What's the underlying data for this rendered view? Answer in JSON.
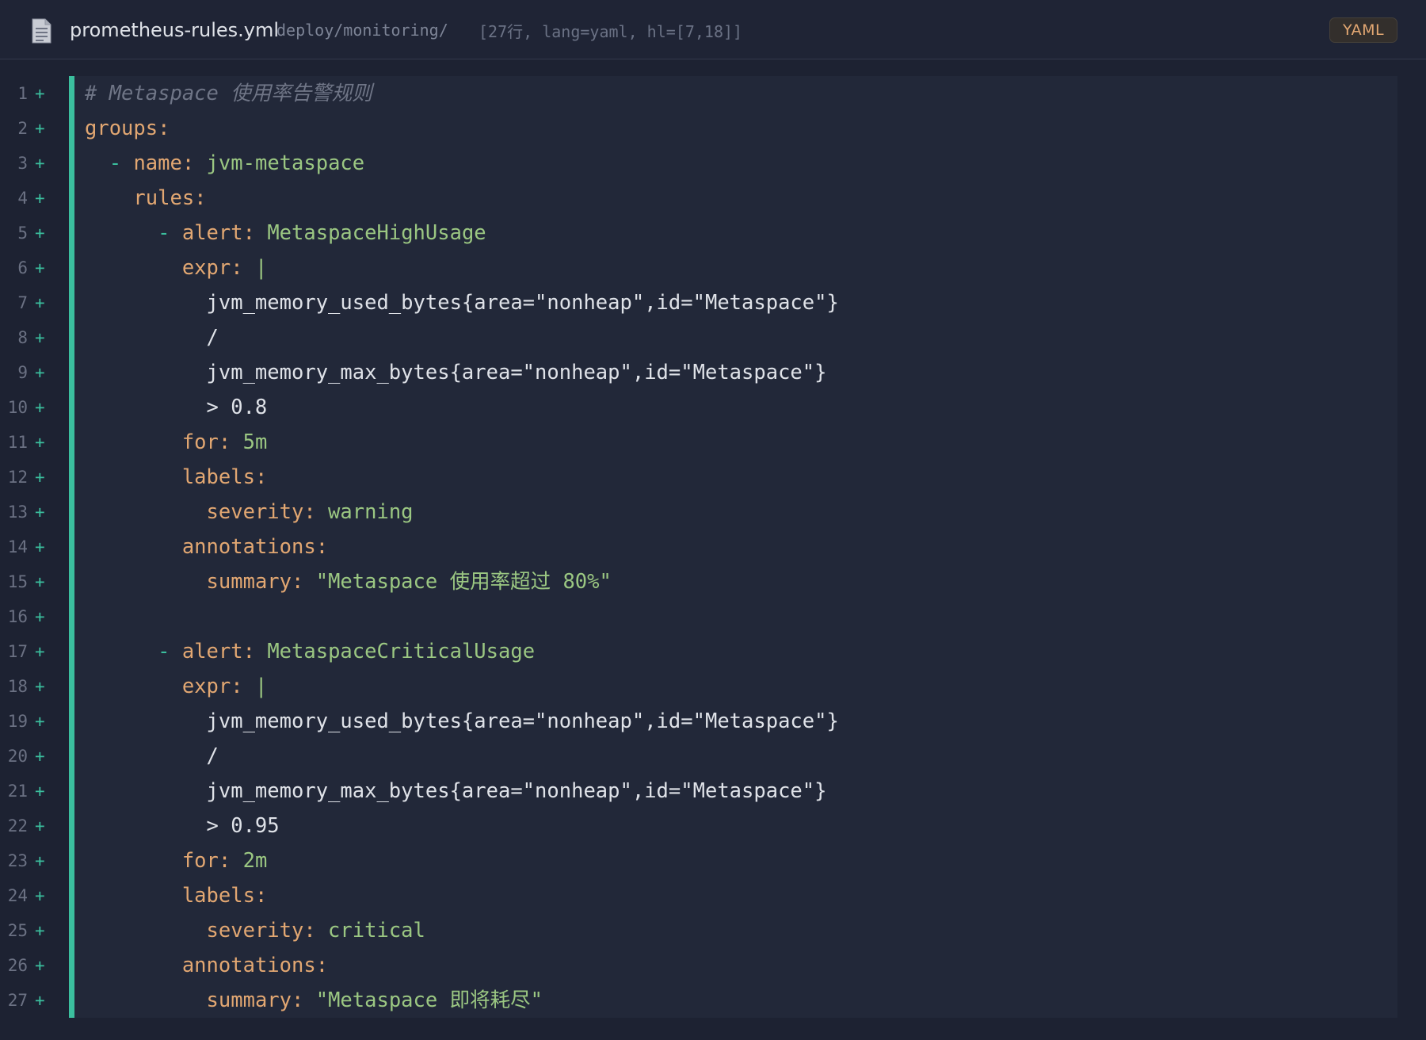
{
  "header": {
    "file_name": "prometheus-rules.yml",
    "path": "deploy/monitoring/",
    "meta": "[27行, lang=yaml, hl=[7,18]]",
    "lang_badge": "YAML",
    "file_icon": "document-icon"
  },
  "colors": {
    "added_bar": "#3bbf9e",
    "key": "#e2a772",
    "value": "#9bc782",
    "comment": "#6f7586"
  },
  "lines": [
    {
      "n": "1",
      "tokens": [
        {
          "t": "# Metaspace 使用率告警规则",
          "c": "comment"
        }
      ]
    },
    {
      "n": "2",
      "tokens": [
        {
          "t": "groups:",
          "c": "key"
        }
      ]
    },
    {
      "n": "3",
      "tokens": [
        {
          "t": "  ",
          "c": "text"
        },
        {
          "t": "-",
          "c": "dash"
        },
        {
          "t": " ",
          "c": "text"
        },
        {
          "t": "name:",
          "c": "key"
        },
        {
          "t": " jvm-metaspace",
          "c": "str"
        }
      ]
    },
    {
      "n": "4",
      "tokens": [
        {
          "t": "    ",
          "c": "text"
        },
        {
          "t": "rules:",
          "c": "key"
        }
      ]
    },
    {
      "n": "5",
      "tokens": [
        {
          "t": "      ",
          "c": "text"
        },
        {
          "t": "-",
          "c": "dash"
        },
        {
          "t": " ",
          "c": "text"
        },
        {
          "t": "alert:",
          "c": "key"
        },
        {
          "t": " MetaspaceHighUsage",
          "c": "str"
        }
      ]
    },
    {
      "n": "6",
      "tokens": [
        {
          "t": "        ",
          "c": "text"
        },
        {
          "t": "expr:",
          "c": "key"
        },
        {
          "t": " |",
          "c": "pipe"
        }
      ]
    },
    {
      "n": "7",
      "tokens": [
        {
          "t": "          jvm_memory_used_bytes{area=\"nonheap\",id=\"Metaspace\"}",
          "c": "text"
        }
      ]
    },
    {
      "n": "8",
      "tokens": [
        {
          "t": "          /",
          "c": "text"
        }
      ]
    },
    {
      "n": "9",
      "tokens": [
        {
          "t": "          jvm_memory_max_bytes{area=\"nonheap\",id=\"Metaspace\"}",
          "c": "text"
        }
      ]
    },
    {
      "n": "10",
      "tokens": [
        {
          "t": "          > 0.8",
          "c": "text"
        }
      ]
    },
    {
      "n": "11",
      "tokens": [
        {
          "t": "        ",
          "c": "text"
        },
        {
          "t": "for:",
          "c": "key"
        },
        {
          "t": " 5m",
          "c": "str"
        }
      ]
    },
    {
      "n": "12",
      "tokens": [
        {
          "t": "        ",
          "c": "text"
        },
        {
          "t": "labels:",
          "c": "key"
        }
      ]
    },
    {
      "n": "13",
      "tokens": [
        {
          "t": "          ",
          "c": "text"
        },
        {
          "t": "severity:",
          "c": "key"
        },
        {
          "t": " warning",
          "c": "str"
        }
      ]
    },
    {
      "n": "14",
      "tokens": [
        {
          "t": "        ",
          "c": "text"
        },
        {
          "t": "annotations:",
          "c": "key"
        }
      ]
    },
    {
      "n": "15",
      "tokens": [
        {
          "t": "          ",
          "c": "text"
        },
        {
          "t": "summary:",
          "c": "key"
        },
        {
          "t": " \"Metaspace 使用率超过 80%\"",
          "c": "str"
        }
      ]
    },
    {
      "n": "16",
      "tokens": [
        {
          "t": "",
          "c": "text"
        }
      ]
    },
    {
      "n": "17",
      "tokens": [
        {
          "t": "      ",
          "c": "text"
        },
        {
          "t": "-",
          "c": "dash"
        },
        {
          "t": " ",
          "c": "text"
        },
        {
          "t": "alert:",
          "c": "key"
        },
        {
          "t": " MetaspaceCriticalUsage",
          "c": "str"
        }
      ]
    },
    {
      "n": "18",
      "tokens": [
        {
          "t": "        ",
          "c": "text"
        },
        {
          "t": "expr:",
          "c": "key"
        },
        {
          "t": " |",
          "c": "pipe"
        }
      ]
    },
    {
      "n": "19",
      "tokens": [
        {
          "t": "          jvm_memory_used_bytes{area=\"nonheap\",id=\"Metaspace\"}",
          "c": "text"
        }
      ]
    },
    {
      "n": "20",
      "tokens": [
        {
          "t": "          /",
          "c": "text"
        }
      ]
    },
    {
      "n": "21",
      "tokens": [
        {
          "t": "          jvm_memory_max_bytes{area=\"nonheap\",id=\"Metaspace\"}",
          "c": "text"
        }
      ]
    },
    {
      "n": "22",
      "tokens": [
        {
          "t": "          > 0.95",
          "c": "text"
        }
      ]
    },
    {
      "n": "23",
      "tokens": [
        {
          "t": "        ",
          "c": "text"
        },
        {
          "t": "for:",
          "c": "key"
        },
        {
          "t": " 2m",
          "c": "str"
        }
      ]
    },
    {
      "n": "24",
      "tokens": [
        {
          "t": "        ",
          "c": "text"
        },
        {
          "t": "labels:",
          "c": "key"
        }
      ]
    },
    {
      "n": "25",
      "tokens": [
        {
          "t": "          ",
          "c": "text"
        },
        {
          "t": "severity:",
          "c": "key"
        },
        {
          "t": " critical",
          "c": "str"
        }
      ]
    },
    {
      "n": "26",
      "tokens": [
        {
          "t": "        ",
          "c": "text"
        },
        {
          "t": "annotations:",
          "c": "key"
        }
      ]
    },
    {
      "n": "27",
      "tokens": [
        {
          "t": "          ",
          "c": "text"
        },
        {
          "t": "summary:",
          "c": "key"
        },
        {
          "t": " \"Metaspace 即将耗尽\"",
          "c": "str"
        }
      ]
    }
  ],
  "gutter_marker": "+"
}
